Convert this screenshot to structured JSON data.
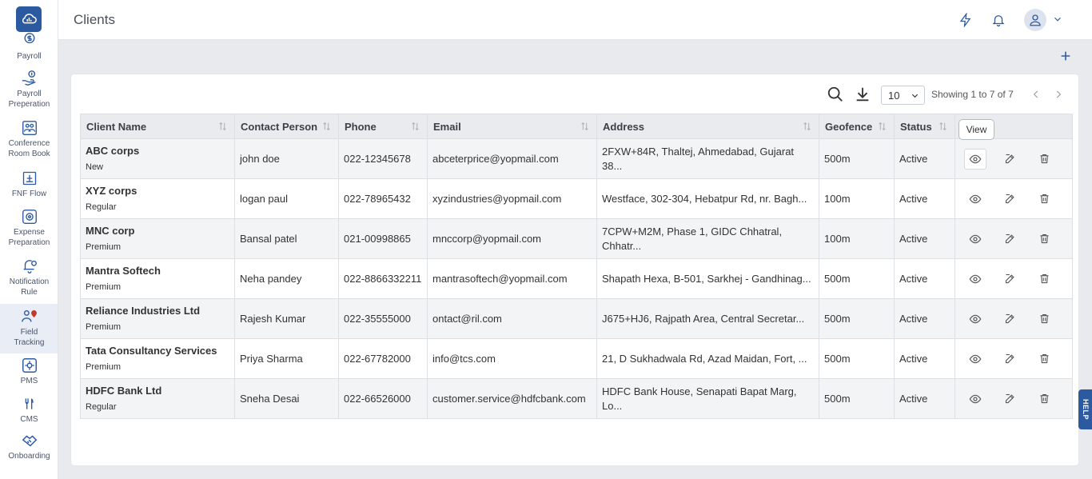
{
  "header": {
    "title": "Clients"
  },
  "sidebar": {
    "items": [
      {
        "label": "Payroll",
        "icon": "dollar-icon"
      },
      {
        "label": "Payroll Preperation",
        "icon": "hand-dollar-icon"
      },
      {
        "label": "Conference Room Book",
        "icon": "conference-icon"
      },
      {
        "label": "FNF Flow",
        "icon": "fnf-icon"
      },
      {
        "label": "Expense Preparation",
        "icon": "expense-icon"
      },
      {
        "label": "Notification Rule",
        "icon": "bell-gear-icon"
      },
      {
        "label": "Field Tracking",
        "icon": "location-person-icon"
      },
      {
        "label": "PMS",
        "icon": "pms-icon"
      },
      {
        "label": "CMS",
        "icon": "fork-knife-icon"
      },
      {
        "label": "Onboarding",
        "icon": "handshake-icon"
      }
    ]
  },
  "toolbar": {
    "page_size": "10",
    "showing": "Showing 1 to 7 of 7"
  },
  "table": {
    "columns": [
      "Client Name",
      "Contact Person",
      "Phone",
      "Email",
      "Address",
      "Geofence",
      "Status"
    ],
    "rows": [
      {
        "name": "ABC corps",
        "type": "New",
        "contact": "john doe",
        "phone": "022-12345678",
        "email": "abceterprice@yopmail.com",
        "address": "2FXW+84R, Thaltej, Ahmedabad, Gujarat 38...",
        "geofence": "500m",
        "status": "Active"
      },
      {
        "name": "XYZ corps",
        "type": "Regular",
        "contact": "logan paul",
        "phone": "022-78965432",
        "email": "xyzindustries@yopmail.com",
        "address": "Westface, 302-304, Hebatpur Rd, nr. Bagh...",
        "geofence": "100m",
        "status": "Active"
      },
      {
        "name": "MNC corp",
        "type": "Premium",
        "contact": "Bansal patel",
        "phone": "021-00998865",
        "email": "mnccorp@yopmail.com",
        "address": "7CPW+M2M, Phase 1, GIDC Chhatral, Chhatr...",
        "geofence": "100m",
        "status": "Active"
      },
      {
        "name": "Mantra Softech",
        "type": "Premium",
        "contact": "Neha pandey",
        "phone": "022-8866332211",
        "email": "mantrasoftech@yopmail.com",
        "address": "Shapath Hexa, B-501, Sarkhej - Gandhinag...",
        "geofence": "500m",
        "status": "Active"
      },
      {
        "name": "Reliance Industries Ltd",
        "type": "Premium",
        "contact": "Rajesh Kumar",
        "phone": "022-35555000",
        "email": "ontact@ril.com",
        "address": "J675+HJ6, Rajpath Area, Central Secretar...",
        "geofence": "500m",
        "status": "Active"
      },
      {
        "name": "Tata Consultancy Services",
        "type": "Premium",
        "contact": "Priya Sharma",
        "phone": "022-67782000",
        "email": "info@tcs.com",
        "address": "21, D Sukhadwala Rd, Azad Maidan, Fort, ...",
        "geofence": "500m",
        "status": "Active"
      },
      {
        "name": "HDFC Bank Ltd",
        "type": "Regular",
        "contact": "Sneha Desai",
        "phone": "022-66526000",
        "email": "customer.service@hdfcbank.com",
        "address": "HDFC Bank House, Senapati Bapat Marg, Lo...",
        "geofence": "500m",
        "status": "Active"
      }
    ]
  },
  "tooltip": "View",
  "help": "HELP",
  "colors": {
    "brand": "#2c5aa0",
    "active_status": "#2e9b3e"
  }
}
